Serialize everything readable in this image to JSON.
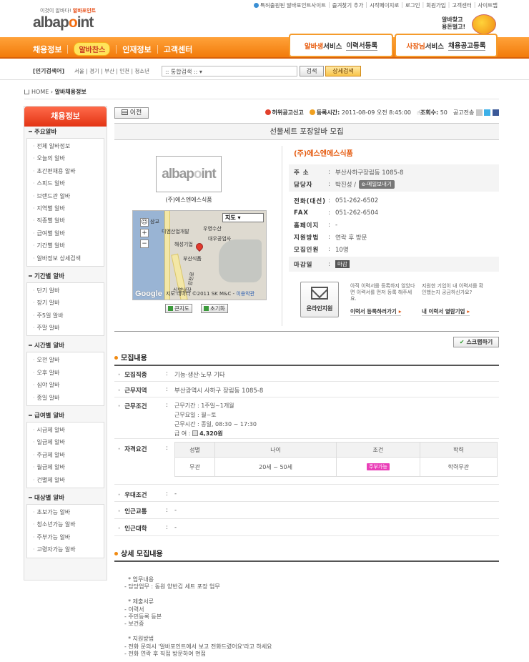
{
  "top_links": [
    "특허출원된 알바포인트사이트",
    "즐겨찾기 추가",
    "시작페이지로",
    "로그인",
    "회원가입",
    "고객센터",
    "사이트맵"
  ],
  "logo": {
    "tagline_prefix": "이것이 알바다!",
    "tagline_brand": "알바포인트",
    "part1": "albap",
    "part2": "o",
    "part3": "int"
  },
  "badge": {
    "line1": "알바찾고",
    "line2": "용돈벌고!"
  },
  "nav": {
    "items": [
      "채용정보",
      "알바찬스",
      "인재정보",
      "고객센터"
    ],
    "special_sub": "채용정보"
  },
  "service": {
    "alba_title_a": "알바생",
    "alba_title_b": "서비스",
    "alba_link": "이력서등록",
    "boss_title_a": "사장님",
    "boss_title_b": "서비스",
    "boss_link": "채용공고등록"
  },
  "search": {
    "popular_label": "[인기검색어]",
    "popular_words": "서울 | 경기 | 부산 | 인천 | 청소년",
    "select_value": ":: 통합검색 ::",
    "search_button": "검색",
    "detail_button": "상세검색"
  },
  "breadcrumb": {
    "home": "HOME",
    "current": "알바채용정보"
  },
  "sidebar": {
    "title": "채용정보",
    "groups": [
      {
        "head": "주요알바",
        "items": [
          "전체 알바정보",
          "오늘의 알바",
          "초간편채용 알바",
          "스피드 알바",
          "브랜드관 알바",
          "지역별 알바",
          "직종별 알바",
          "급여별 알바",
          "기간별 알바",
          "알바정보 상세검색"
        ]
      },
      {
        "head": "기간별 알바",
        "items": [
          "단기 알바",
          "장기 알바",
          "주5일 알바",
          "주말 알바"
        ]
      },
      {
        "head": "시간별 알바",
        "items": [
          "오전 알바",
          "오후 알바",
          "심야 알바",
          "종일 알바"
        ]
      },
      {
        "head": "급여별 알바",
        "items": [
          "시급제 알바",
          "일급제 알바",
          "주급제 알바",
          "월급제 알바",
          "건별제 알바"
        ]
      },
      {
        "head": "대상별 알바",
        "items": [
          "초보가능 알바",
          "청소년가능 알바",
          "주부가능 알바",
          "고령자가능 알바"
        ]
      }
    ]
  },
  "toolbar": {
    "prev": "이전",
    "report": "허위공고신고",
    "reg_label": "등록시간:",
    "reg_value": "2011-08-09 오전 8:45:00",
    "views_label": "조회수:",
    "views_value": "50",
    "share_label": "공고전송"
  },
  "post": {
    "title": "선물세트 포장알바 모집"
  },
  "company": {
    "logo_a": "albap",
    "logo_b": "o",
    "logo_c": "int",
    "caption": "(주)에스엔에스식품",
    "name": "(주)에스엔에스식품",
    "info": [
      {
        "key": "주 소",
        "value": "부산사하구장림동 1085-8"
      },
      {
        "key": "담당자",
        "value": "박진성 /"
      }
    ],
    "email_button": "e-메일보내기",
    "contact": [
      {
        "key": "전화(대선)",
        "value": "051-262-6502"
      },
      {
        "key": "FAX",
        "value": "051-262-6504"
      },
      {
        "key": "홈페이지",
        "value": "-"
      },
      {
        "key": "지원방법",
        "value": "연락 후 방문"
      },
      {
        "key": "모집인원",
        "value": "10명"
      }
    ],
    "deadline_key": "마감일",
    "deadline_badge": "마감"
  },
  "map": {
    "type_select": "지도",
    "google": "Google",
    "credit": "지도 데이터 ©2011 SK M&C -",
    "terms": "이용약관",
    "labels": [
      "삼교",
      "디엠산업개발",
      "우영수산",
      "대우공업사",
      "해성기업",
      "부산식품",
      "신영냉장",
      "감천로"
    ],
    "bigmap_button": "큰지도",
    "reset_button": "초기화"
  },
  "apply": {
    "online": "온라인지원",
    "note1": "아직 이력서를 등록하지 않았다면 이력서를 먼저 등록 해주세요.",
    "link1": "이력서 등록하러가기",
    "note2": "지원한 기업이 내 이력서를 확인했는지 궁금하신가요?",
    "link2": "내 이력서 열람기업"
  },
  "scrap_button": "스크랩하기",
  "recruit": {
    "title": "모집내용",
    "job_key": "모집직종",
    "job_value": "기능·생산·노무 기타",
    "area_key": "근무지역",
    "area_value": "부산광역시 사하구 장림동 1085-8",
    "cond_key": "근무조건",
    "cond_lines": [
      "근무기간 :  1주일~1개월",
      "근무요일 :  월~토",
      "근무시간 :  종일, 08:30 ~ 17:30"
    ],
    "pay_label": "급       여 :",
    "pay_value": "4,320원",
    "qual_key": "자격요건",
    "qual_headers": [
      "성별",
      "나이",
      "조건",
      "학력"
    ],
    "qual_values": [
      "무관",
      "20세 ~ 50세",
      "주부가능",
      "학력무관"
    ],
    "pref_key": "우대조건",
    "pref_value": "-",
    "transit_key": "인근교통",
    "transit_value": "-",
    "univ_key": "인근대학",
    "univ_value": "-"
  },
  "detail": {
    "title": "상세 모집내용",
    "body": "  * 업무내용\n- 담당업무 : 동원 양반김 세트 포장 업무\n\n  * 제출서류\n- 이력서\n- 주민등록 등본\n- 보건증\n\n  * 지원방법\n- 전화 문의시 '알바포인트에서 보고 전화드렸어요'라고 하세요\n- 전화 연락 후 직접 방문하여 면접"
  },
  "colors": {
    "accent": "#f27b0a",
    "brand_red": "#e33414",
    "badge_pink": "#ea3fb8"
  }
}
